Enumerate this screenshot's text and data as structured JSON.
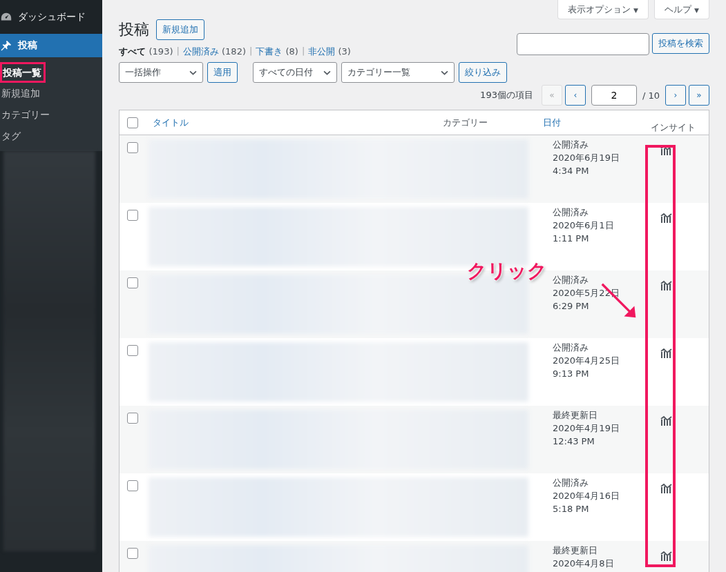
{
  "sidebar": {
    "items": [
      {
        "label": "ダッシュボード",
        "kind": "dashboard",
        "selected": false
      },
      {
        "label": "投稿",
        "kind": "posts",
        "selected": true
      }
    ],
    "submenu": [
      {
        "label": "投稿一覧",
        "selected": true,
        "highlighted": true
      },
      {
        "label": "新規追加",
        "selected": false,
        "highlighted": false
      },
      {
        "label": "カテゴリー",
        "selected": false,
        "highlighted": false
      },
      {
        "label": "タグ",
        "selected": false,
        "highlighted": false
      }
    ]
  },
  "screen_options": [
    {
      "label": "表示オプション",
      "caret": "▼"
    },
    {
      "label": "ヘルプ",
      "caret": "▼"
    }
  ],
  "filter_separator": "|",
  "page_title": "投稿",
  "add_new": "新規追加",
  "status_filters": [
    {
      "label": "すべて",
      "count": "(193)",
      "selected": true
    },
    {
      "label": "公開済み",
      "count": "(182)",
      "selected": false
    },
    {
      "label": "下書き",
      "count": "(8)",
      "selected": false
    },
    {
      "label": "非公開",
      "count": "(3)",
      "selected": false
    }
  ],
  "search": {
    "button": "投稿を検索"
  },
  "bulk_action": {
    "value": "一括操作",
    "button": "適用"
  },
  "date_filter": "すべての日付",
  "category_filter": "カテゴリー一覧",
  "filter_button": "絞り込み",
  "pagination": {
    "items": "193個の項目",
    "current": "2",
    "total": "/ 10",
    "buttons": [
      {
        "label": "«",
        "disabled": true
      },
      {
        "label": "‹",
        "disabled": false
      },
      {
        "label": "›",
        "disabled": false
      },
      {
        "label": "»",
        "disabled": false
      }
    ]
  },
  "table": {
    "select_all_checked": false,
    "columns": [
      {
        "label": "タイトル",
        "sortable": true
      },
      {
        "label": "カテゴリー",
        "sortable": false
      },
      {
        "label": "日付",
        "sortable": true
      },
      {
        "label": "インサイト",
        "sortable": false
      }
    ],
    "rows": [
      {
        "checked": false,
        "status": "公開済み",
        "date": "2020年6月19日",
        "time": "4:34 PM"
      },
      {
        "checked": false,
        "status": "公開済み",
        "date": "2020年6月1日",
        "time": "1:11 PM"
      },
      {
        "checked": false,
        "status": "公開済み",
        "date": "2020年5月22日",
        "time": "6:29 PM"
      },
      {
        "checked": false,
        "status": "公開済み",
        "date": "2020年4月25日",
        "time": "9:13 PM"
      },
      {
        "checked": false,
        "status": "最終更新日",
        "date": "2020年4月19日",
        "time": "12:43 PM"
      },
      {
        "checked": false,
        "status": "公開済み",
        "date": "2020年4月16日",
        "time": "5:18 PM"
      },
      {
        "checked": false,
        "status": "最終更新日",
        "date": "2020年4月8日"
      }
    ]
  },
  "annotation": {
    "label": "クリック"
  }
}
